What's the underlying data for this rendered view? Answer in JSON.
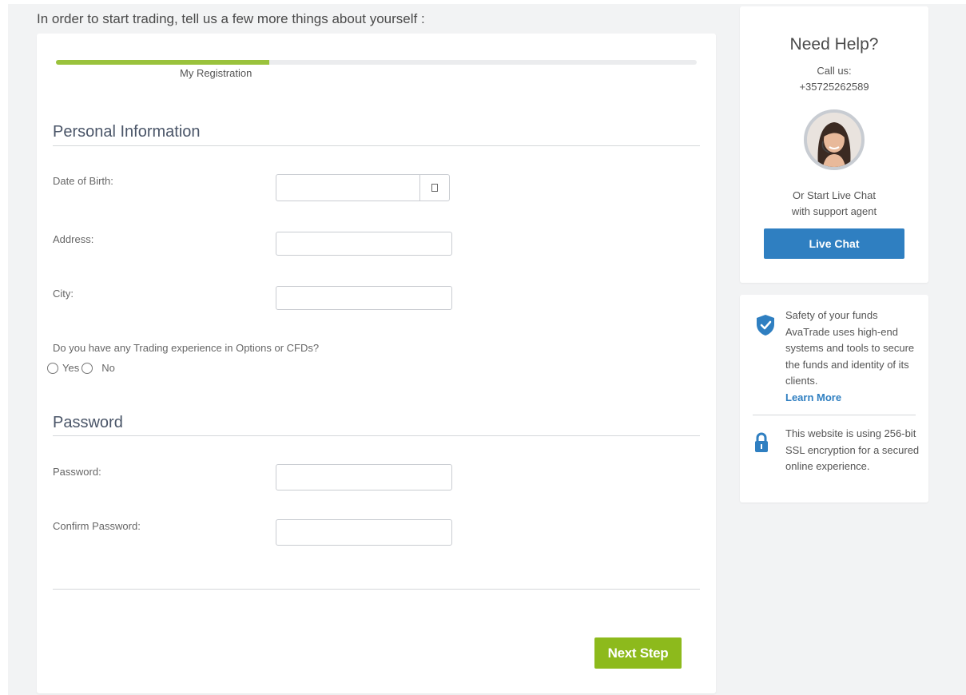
{
  "intro": {
    "text": "In order to start trading, tell us a few more things about yourself :"
  },
  "progress": {
    "label": "My Registration",
    "fraction": 0.333
  },
  "personal": {
    "title": "Personal Information",
    "dob_label": "Date of Birth:",
    "address_label": "Address:",
    "city_label": "City:",
    "dob_value": "",
    "address_value": "",
    "city_value": "",
    "calendar_icon": "calendar-icon",
    "trading_question": "Do you have any Trading experience in Options or CFDs?",
    "yes_label": "Yes",
    "no_label": "No"
  },
  "password": {
    "title": "Password",
    "password_label": "Password:",
    "confirm_label": "Confirm Password:",
    "password_value": "",
    "confirm_value": ""
  },
  "actions": {
    "next_label": "Next Step"
  },
  "help": {
    "title": "Need Help?",
    "call_label": "Call us:",
    "phone": "+35725262589",
    "chat_line1": "Or Start Live Chat",
    "chat_line2": "with support agent",
    "live_chat_label": "Live Chat",
    "avatar_icon": "support-agent-avatar"
  },
  "safety": {
    "shield_icon": "shield-check-icon",
    "line1": "Safety of your funds",
    "body": "AvaTrade uses high-end systems and tools to secure the funds and identity of its clients.",
    "learn_more": "Learn More",
    "lock_icon": "lock-icon",
    "ssl_text": "This website is using 256-bit SSL encryption for a secured online experience."
  },
  "colors": {
    "progress_green": "#9ac23c",
    "next_green": "#8dba1c",
    "chat_blue": "#2f7fc1",
    "shield_blue": "#2f7fc1"
  }
}
